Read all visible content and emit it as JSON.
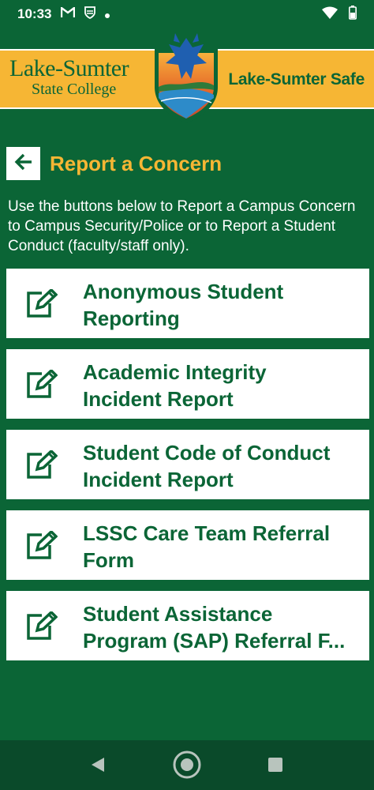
{
  "status_bar": {
    "time": "10:33",
    "icons": [
      "gmail-icon",
      "shield-app-icon",
      "dot-icon",
      "wifi-icon",
      "battery-icon"
    ]
  },
  "banner": {
    "logo_line1": "Lake-Sumter",
    "logo_line2": "State College",
    "app_name": "Lake-Sumter Safe"
  },
  "header": {
    "title": "Report a Concern",
    "back_icon": "arrow-left-icon"
  },
  "intro_text": "Use the buttons below to Report a Campus Concern to Campus Security/Police or to Report a Student Conduct (faculty/staff only).",
  "buttons": [
    {
      "line1": "Anonymous Student",
      "line2": "Reporting",
      "icon": "edit-icon"
    },
    {
      "line1": "Academic Integrity",
      "line2": "Incident Report",
      "icon": "edit-icon"
    },
    {
      "line1": "Student Code of Conduct",
      "line2": "Incident Report",
      "icon": "edit-icon"
    },
    {
      "line1": "LSSC Care Team Referral",
      "line2": "Form",
      "icon": "edit-icon"
    },
    {
      "line1": "Student Assistance",
      "line2": "Program (SAP) Referral F...",
      "icon": "edit-icon"
    }
  ],
  "colors": {
    "primary_green": "#0b6536",
    "accent_gold": "#f6b634",
    "nav_dark": "#0a4a2a"
  },
  "nav_bar": {
    "back": "triangle-back-icon",
    "home": "circle-home-icon",
    "recents": "square-recents-icon"
  }
}
